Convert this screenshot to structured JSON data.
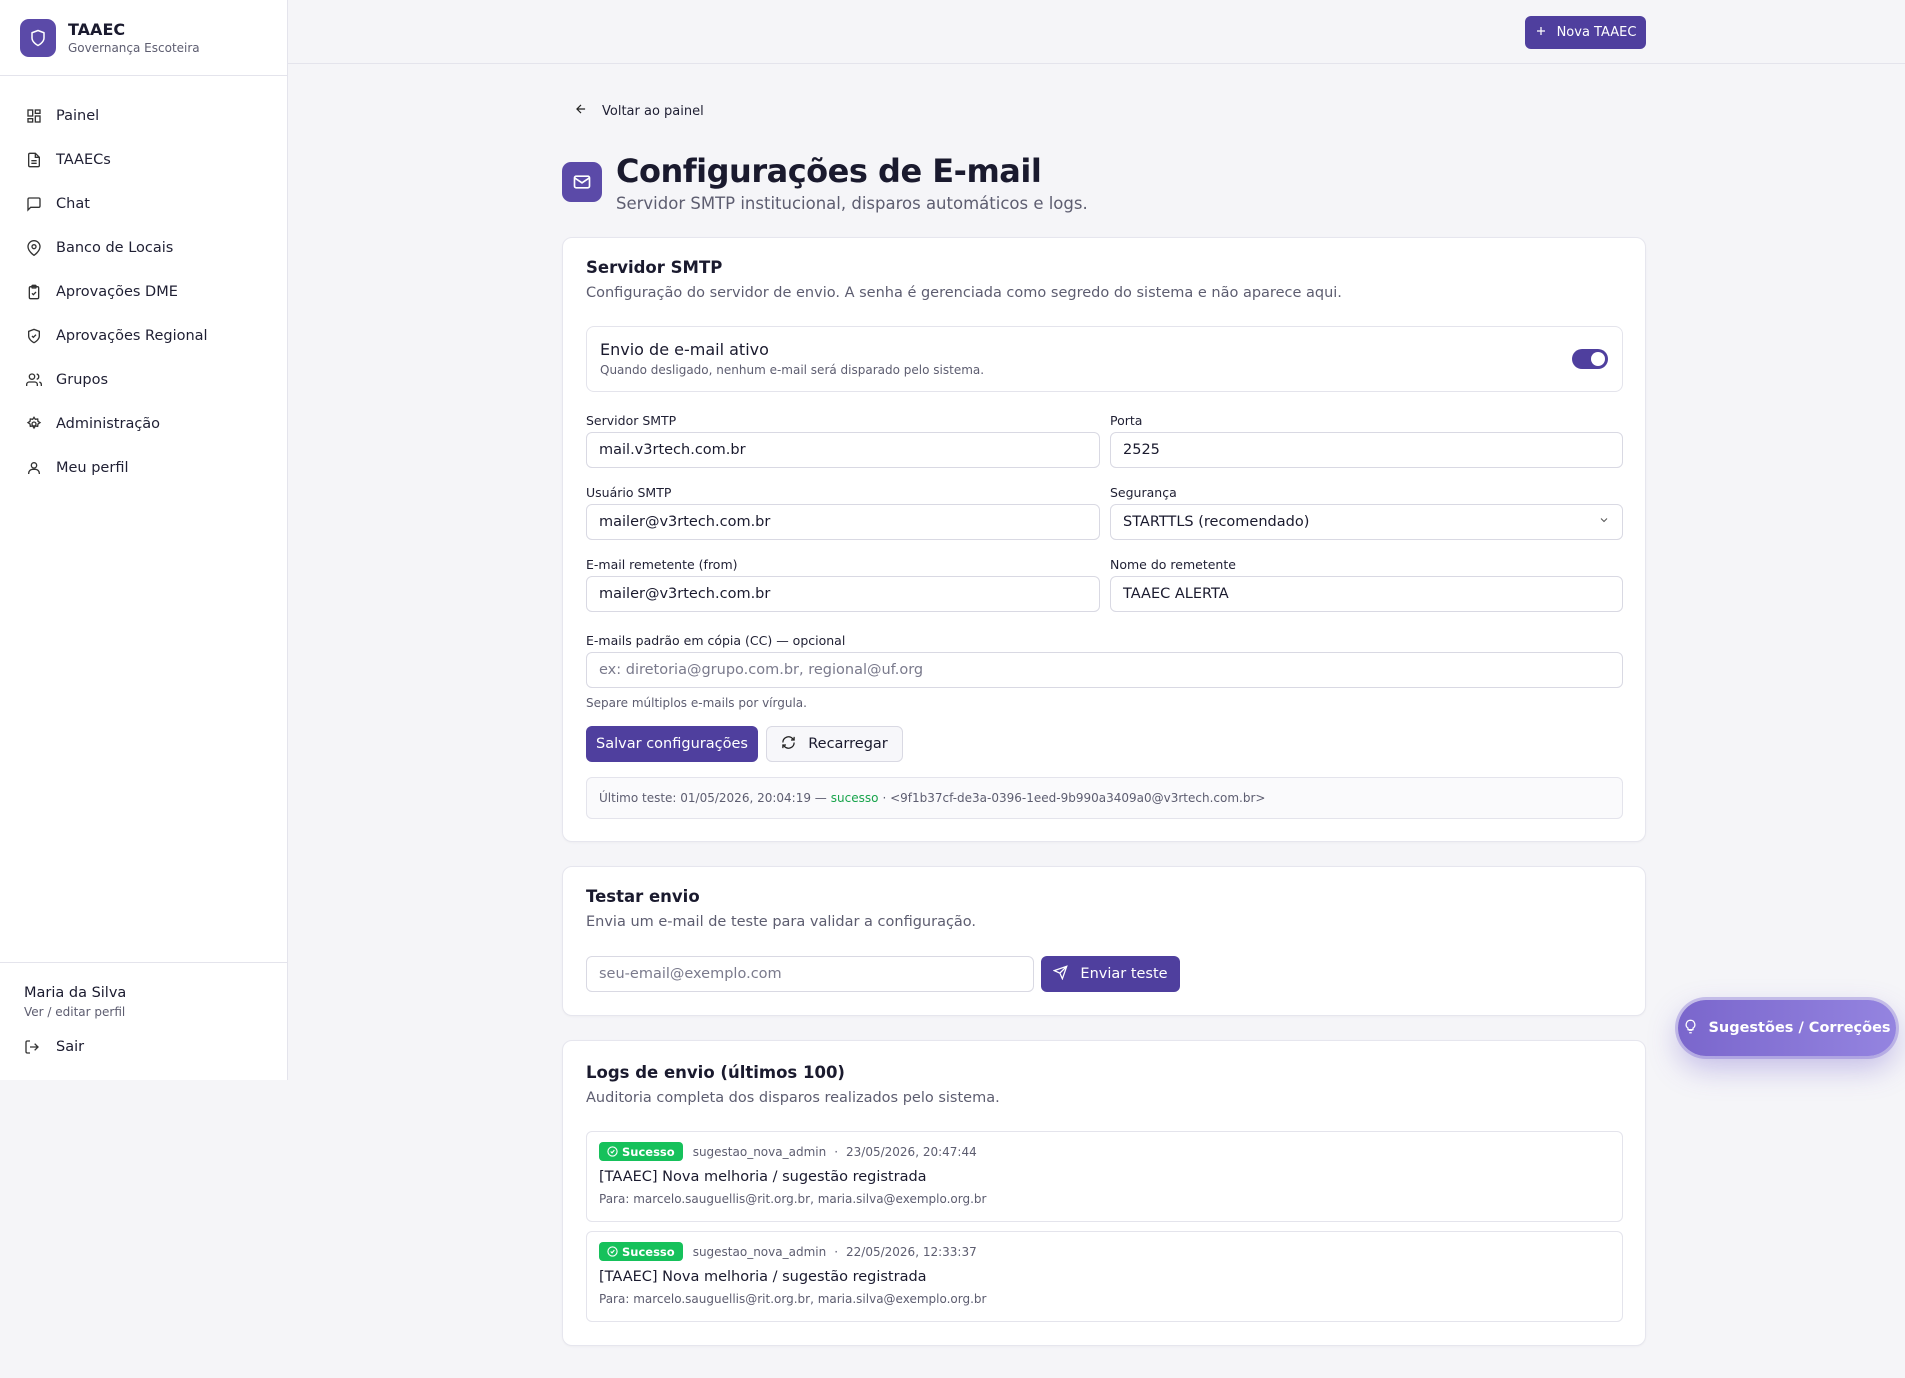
{
  "brand": {
    "title": "TAAEC",
    "subtitle": "Governança Escoteira"
  },
  "sidebar": {
    "items": [
      {
        "label": "Painel",
        "icon": "dashboard-icon"
      },
      {
        "label": "TAAECs",
        "icon": "document-icon"
      },
      {
        "label": "Chat",
        "icon": "chat-icon"
      },
      {
        "label": "Banco de Locais",
        "icon": "map-pin-icon"
      },
      {
        "label": "Aprovações DME",
        "icon": "clipboard-check-icon"
      },
      {
        "label": "Aprovações Regional",
        "icon": "shield-check-icon"
      },
      {
        "label": "Grupos",
        "icon": "users-icon"
      },
      {
        "label": "Administração",
        "icon": "gear-icon"
      },
      {
        "label": "Meu perfil",
        "icon": "user-icon"
      }
    ],
    "user_name": "Maria da Silva",
    "user_edit": "Ver / editar perfil",
    "logout": "Sair"
  },
  "topbar": {
    "new_button": "Nova TAAEC"
  },
  "page": {
    "back": "Voltar ao painel",
    "title": "Configurações de E-mail",
    "subtitle": "Servidor SMTP institucional, disparos automáticos e logs."
  },
  "smtp": {
    "title": "Servidor SMTP",
    "desc": "Configuração do servidor de envio. A senha é gerenciada como segredo do sistema e não aparece aqui.",
    "toggle_title": "Envio de e-mail ativo",
    "toggle_sub": "Quando desligado, nenhum e-mail será disparado pelo sistema.",
    "toggle_on": true,
    "server_label": "Servidor SMTP",
    "server_value": "mail.v3rtech.com.br",
    "port_label": "Porta",
    "port_value": "2525",
    "user_label": "Usuário SMTP",
    "user_value": "mailer@v3rtech.com.br",
    "security_label": "Segurança",
    "security_value": "STARTTLS (recomendado)",
    "from_label": "E-mail remetente (from)",
    "from_value": "mailer@v3rtech.com.br",
    "sender_label": "Nome do remetente",
    "sender_value": "TAAEC ALERTA",
    "cc_label": "E-mails padrão em cópia (CC) — opcional",
    "cc_placeholder": "ex: diretoria@grupo.com.br, regional@uf.org",
    "cc_hint": "Separe múltiplos e-mails por vírgula.",
    "save_button": "Salvar configurações",
    "reload_button": "Recarregar",
    "last_test_prefix": "Último teste: 01/05/2026, 20:04:19 —",
    "last_test_status": "sucesso",
    "last_test_suffix": "· <9f1b37cf-de3a-0396-1eed-9b990a3409a0@v3rtech.com.br>"
  },
  "test": {
    "title": "Testar envio",
    "desc": "Envia um e-mail de teste para validar a configuração.",
    "placeholder": "seu-email@exemplo.com",
    "send_button": "Enviar teste"
  },
  "logs": {
    "title": "Logs de envio (últimos 100)",
    "desc": "Auditoria completa dos disparos realizados pelo sistema.",
    "items": [
      {
        "status": "Sucesso",
        "type": "sugestao_nova_admin",
        "date": "23/05/2026, 20:47:44",
        "subject": "[TAAEC] Nova melhoria / sugestão registrada",
        "to": "Para: marcelo.sauguellis@rit.org.br, maria.silva@exemplo.org.br"
      },
      {
        "status": "Sucesso",
        "type": "sugestao_nova_admin",
        "date": "22/05/2026, 12:33:37",
        "subject": "[TAAEC] Nova melhoria / sugestão registrada",
        "to": "Para: marcelo.sauguellis@rit.org.br, maria.silva@exemplo.org.br"
      }
    ]
  },
  "fab": {
    "label": "Sugestões / Correções"
  },
  "colors": {
    "accent": "#4f3f9e",
    "success": "#16c15b",
    "success_text": "#16a34a"
  }
}
